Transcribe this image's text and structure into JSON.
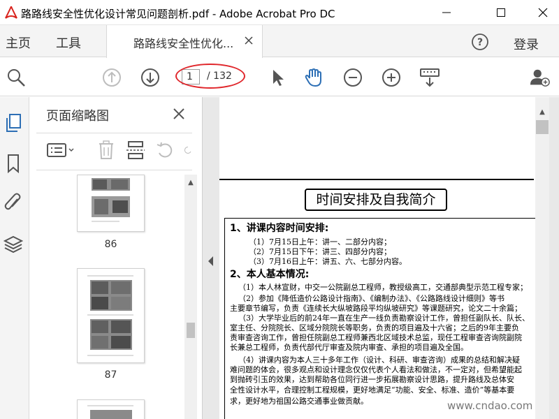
{
  "window": {
    "title": "路路线安全性优化设计常见问题剖析.pdf - Adobe Acrobat Pro DC"
  },
  "menu": {
    "home": "主页",
    "tools": "工具",
    "tab_title": "路路线安全性优化...",
    "login": "登录"
  },
  "toolbar": {
    "current_page": "1",
    "total_pages": "/ 132"
  },
  "thumbnails": {
    "title": "页面缩略图",
    "pages": [
      {
        "label": "86"
      },
      {
        "label": "87"
      }
    ]
  },
  "document": {
    "heading": "时间安排及自我简介",
    "section1": "1、讲课内容时间安排:",
    "schedule": [
      "（1）7月15日上午：讲一、二部分内容；",
      "（2）7月15日下午：讲三、四部分内容；",
      "（3）7月16日上午：讲五、六、七部分内容。"
    ],
    "section2": "2、本人基本情况:",
    "bio": [
      "（1）本人林宣财，中交一公院副总工程师，教授级高工，交通部典型示范工程专家；",
      "（2）参加《降低造价公路设计指南》、《编制办法》、《公路路线设计细则》等书",
      "主要章节编写，负责《连续长大纵坡路段平均纵坡研究》等课题研究，论文二十余篇；",
      "（3）大学毕业后的前24年一直在生产一线负责勘察设计工作，曾担任副队长、队长、",
      "室主任、分院院长、区域分院院长等职务，负责的项目遍及十六省；之后的9年主要负",
      "责审查咨询工作，曾担任院副总工程师兼西北区域技术总监，现任工程审查咨询院副院",
      "长兼总工程师，负责代部代厅审查及院内审查、承担的项目遍及全国。",
      "（4）讲课内容为本人三十多年工作（设计、科研、审查咨询）成果的总结和解决疑",
      "难问题的体会，很多观点和设计理念仅仅代表个人看法和做法，不一定对，但希望能起",
      "到抛砖引玉的效果，达到帮助各位同行进一步拓展勘察设计思路，提升路线及总体安",
      "全性设计水平，合理控制工程规模，更好地满足“功能、安全、标准、造价”等基本要",
      "求，更好地为祖国公路交通事业做贡献。"
    ],
    "watermark": "www.cndao.com"
  },
  "colors": {
    "accent_blue": "#2d6fb5",
    "annotation_red": "#e0262b",
    "acrobat_red": "#d9221c"
  }
}
